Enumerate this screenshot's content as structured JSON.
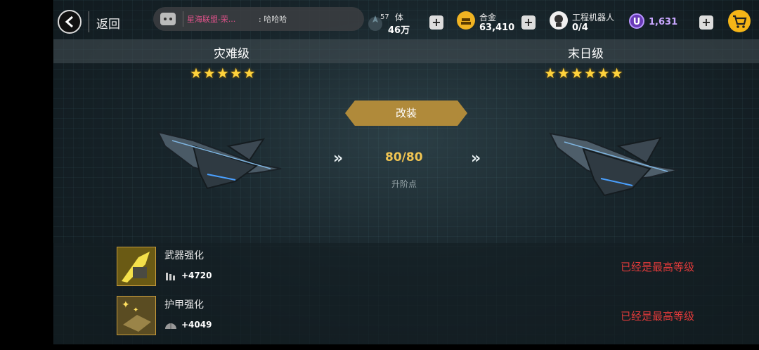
{
  "header": {
    "back_label": "返回",
    "chat": {
      "channel": "星海联盟-荣...",
      "text": ": 哈哈哈"
    },
    "resources": {
      "stamina": {
        "level": "57",
        "label": "体",
        "value": "46万"
      },
      "alloy": {
        "label": "合金",
        "value": "63,410"
      },
      "robot": {
        "label": "工程机器人",
        "value": "0/4"
      },
      "premium": {
        "symbol": "U",
        "value": "1,631"
      }
    },
    "plus_symbol": "+"
  },
  "upgrade": {
    "current": {
      "tier": "灾难级",
      "stars": "★★★★★",
      "star_count": 5
    },
    "next": {
      "tier": "末日级",
      "stars": "★★★★★★",
      "star_count": 6
    },
    "modify_label": "改装",
    "arrow_glyph": "»",
    "points": "80/80",
    "points_label": "升阶点"
  },
  "enhancements": [
    {
      "name": "武器强化",
      "bonus": "+4720",
      "status": "已经是最高等级",
      "icon": "weapon-upgrade-icon"
    },
    {
      "name": "护甲强化",
      "bonus": "+4049",
      "status": "已经是最高等级",
      "icon": "armor-upgrade-icon"
    }
  ],
  "colors": {
    "accent_gold": "#b08a3a",
    "points_gold": "#f0c452",
    "star_yellow": "#ffd23c",
    "max_level_red": "#e03a3a",
    "premium_purple": "#6a3bb8"
  }
}
